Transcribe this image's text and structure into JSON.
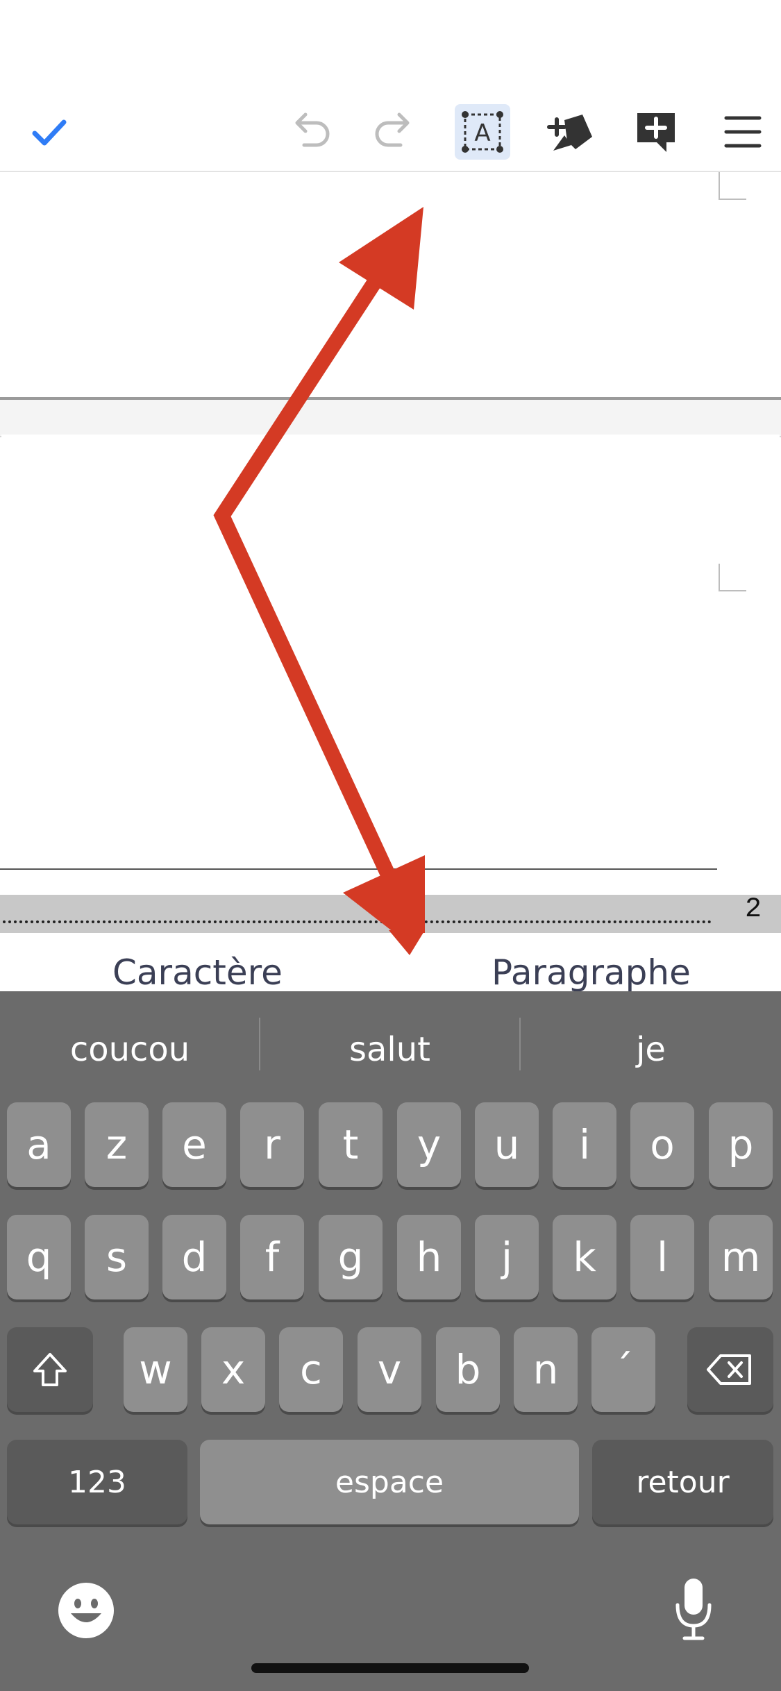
{
  "toolbar": {
    "icons": [
      "check-icon",
      "undo-icon",
      "redo-icon",
      "text-frame-icon",
      "insert-shape-icon",
      "add-comment-icon",
      "menu-icon"
    ]
  },
  "document": {
    "page_number": "2"
  },
  "tabs": {
    "character": "Caractère",
    "paragraph": "Paragraphe"
  },
  "keyboard": {
    "suggestions": [
      "coucou",
      "salut",
      "je"
    ],
    "row1": [
      "a",
      "z",
      "e",
      "r",
      "t",
      "y",
      "u",
      "i",
      "o",
      "p"
    ],
    "row2": [
      "q",
      "s",
      "d",
      "f",
      "g",
      "h",
      "j",
      "k",
      "l",
      "m"
    ],
    "row3": [
      "w",
      "x",
      "c",
      "v",
      "b",
      "n",
      "´"
    ],
    "numbers_label": "123",
    "space_label": "espace",
    "return_label": "retour"
  },
  "colors": {
    "accent": "#2f7cf6",
    "annotation_arrow": "#d43a24",
    "keyboard_bg": "#6b6b6b",
    "key_bg": "#8f8f8f",
    "special_key_bg": "#5a5a5a"
  }
}
